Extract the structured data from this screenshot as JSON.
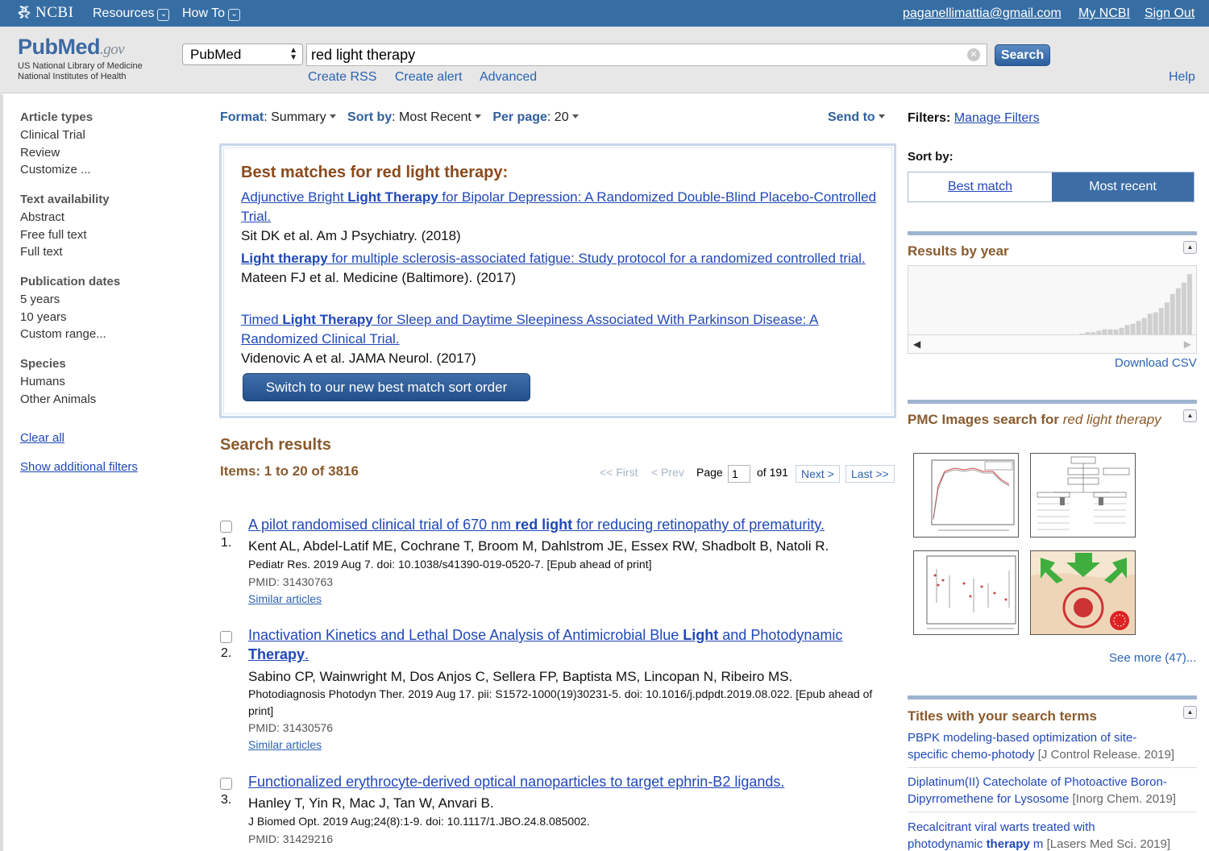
{
  "topbar": {
    "brand": "NCBI",
    "resources": "Resources",
    "howto": "How To",
    "email": "paganellimattia@gmail.com",
    "my_ncbi": "My NCBI",
    "sign_out": "Sign Out"
  },
  "header": {
    "logo_pub": "Pub",
    "logo_med": "Med",
    "logo_gov": ".gov",
    "logo_sub1": "US National Library of Medicine",
    "logo_sub2": "National Institutes of Health",
    "database": "PubMed",
    "query": "red light therapy",
    "search_label": "Search",
    "links": [
      "Create RSS",
      "Create alert",
      "Advanced"
    ],
    "help": "Help"
  },
  "sidebar": {
    "groups": [
      {
        "title": "Article types",
        "items": [
          "Clinical Trial",
          "Review",
          "Customize ..."
        ]
      },
      {
        "title": "Text availability",
        "items": [
          "Abstract",
          "Free full text",
          "Full text"
        ]
      },
      {
        "title": "Publication dates",
        "items": [
          "5 years",
          "10 years",
          "Custom range..."
        ]
      },
      {
        "title": "Species",
        "items": [
          "Humans",
          "Other Animals"
        ]
      }
    ],
    "clear_all": "Clear all",
    "show_additional": "Show additional filters"
  },
  "toolbar": {
    "format_label": "Format",
    "format_value": "Summary",
    "sort_label": "Sort by",
    "sort_value": "Most Recent",
    "perpage_label": "Per page",
    "perpage_value": "20",
    "send_to": "Send to"
  },
  "best_matches": {
    "heading": "Best matches for red light therapy:",
    "items": [
      {
        "pre": "Adjunctive Bright ",
        "bold": "Light Therapy",
        "post": " for Bipolar Depression: A Randomized Double-Blind Placebo-Controlled Trial.",
        "citation": "Sit DK et al. Am J Psychiatry. (2018)"
      },
      {
        "pre": "",
        "bold": "Light therapy",
        "post": " for multiple sclerosis-associated fatigue: Study protocol for a randomized controlled trial.",
        "citation": "Mateen FJ et al. Medicine (Baltimore). (2017)"
      },
      {
        "pre": "Timed ",
        "bold": "Light Therapy",
        "post": " for Sleep and Daytime Sleepiness Associated With Parkinson Disease: A Randomized Clinical Trial.",
        "citation": "Videnovic A et al. JAMA Neurol. (2017)"
      }
    ],
    "switch_button": "Switch to our new best match sort order"
  },
  "results": {
    "heading": "Search results",
    "items_count": "Items: 1 to 20 of 3816",
    "pager": {
      "first": "<< First",
      "prev": "< Prev",
      "page_label": "Page",
      "page": "1",
      "of": "of 191",
      "next": "Next >",
      "last": "Last >>"
    },
    "list": [
      {
        "num": "1.",
        "pre": "A pilot randomised clinical trial of 670 nm ",
        "bold": "red light",
        "post": " for reducing retinopathy of prematurity.",
        "authors": "Kent AL, Abdel-Latif ME, Cochrane T, Broom M, Dahlstrom JE, Essex RW, Shadbolt B, Natoli R.",
        "journal": "Pediatr Res. 2019 Aug 7. doi: 10.1038/s41390-019-0520-7. [Epub ahead of print]",
        "pmid": "PMID: 31430763",
        "similar": "Similar articles"
      },
      {
        "num": "2.",
        "pre": "Inactivation Kinetics and Lethal Dose Analysis of Antimicrobial Blue ",
        "bold": "Light",
        "post": " and Photodynamic ",
        "bold2": "Therapy",
        "post2": ".",
        "authors": "Sabino CP, Wainwright M, Dos Anjos C, Sellera FP, Baptista MS, Lincopan N, Ribeiro MS.",
        "journal": "Photodiagnosis Photodyn Ther. 2019 Aug 17. pii: S1572-1000(19)30231-5. doi: 10.1016/j.pdpdt.2019.08.022. [Epub ahead of print]",
        "pmid": "PMID: 31430576",
        "similar": "Similar articles"
      },
      {
        "num": "3.",
        "pre": "Functionalized erythrocyte-derived optical nanoparticles to target ephrin-B2 ligands.",
        "bold": "",
        "post": "",
        "authors": "Hanley T, Yin R, Mac J, Tan W, Anvari B.",
        "journal": "J Biomed Opt. 2019 Aug;24(8):1-9. doi: 10.1117/1.JBO.24.8.085002.",
        "pmid": "PMID: 31429216",
        "similar": ""
      }
    ]
  },
  "right": {
    "filters_label": "Filters:",
    "manage_filters": "Manage Filters",
    "sort_by": "Sort by:",
    "sort_best": "Best match",
    "sort_recent": "Most recent",
    "results_by_year": "Results by year",
    "download_csv": "Download CSV",
    "year_counts": [
      3,
      3,
      3,
      3,
      3,
      3,
      3,
      4,
      4,
      4,
      5,
      6,
      6,
      6,
      7,
      7,
      7,
      8,
      8,
      8,
      9,
      10,
      10,
      10,
      11,
      12,
      12,
      13,
      14,
      16,
      18,
      18,
      20,
      22,
      22,
      22,
      24,
      28,
      30,
      34,
      38,
      44,
      46,
      52,
      60,
      72,
      80,
      88,
      100
    ],
    "pmc_title_pre": "PMC Images search for ",
    "pmc_title_query": "red light therapy",
    "see_more": "See more (47)...",
    "titles_heading": "Titles with your search terms",
    "titles": [
      {
        "line1": "PBPK modeling-based optimization of site-",
        "line2": "specific chemo-photody",
        "source": "[J Control Release. 2019]"
      },
      {
        "line1": "Diplatinum(II) Catecholate of Photoactive Boron-",
        "line2": "Dipyrromethene for Lysosome",
        "source": "[Inorg Chem. 2019]"
      },
      {
        "line1": "Recalcitrant viral warts treated with",
        "line2": "photodynamic ",
        "line2_bold": "therapy",
        "line2_post": " m",
        "source": "[Lasers Med Sci. 2019]"
      }
    ]
  },
  "colors": {
    "topbar": "#366ea4",
    "link": "#2048b8",
    "section_heading": "#8a5a2c",
    "accent_button": "#3e6da6"
  }
}
